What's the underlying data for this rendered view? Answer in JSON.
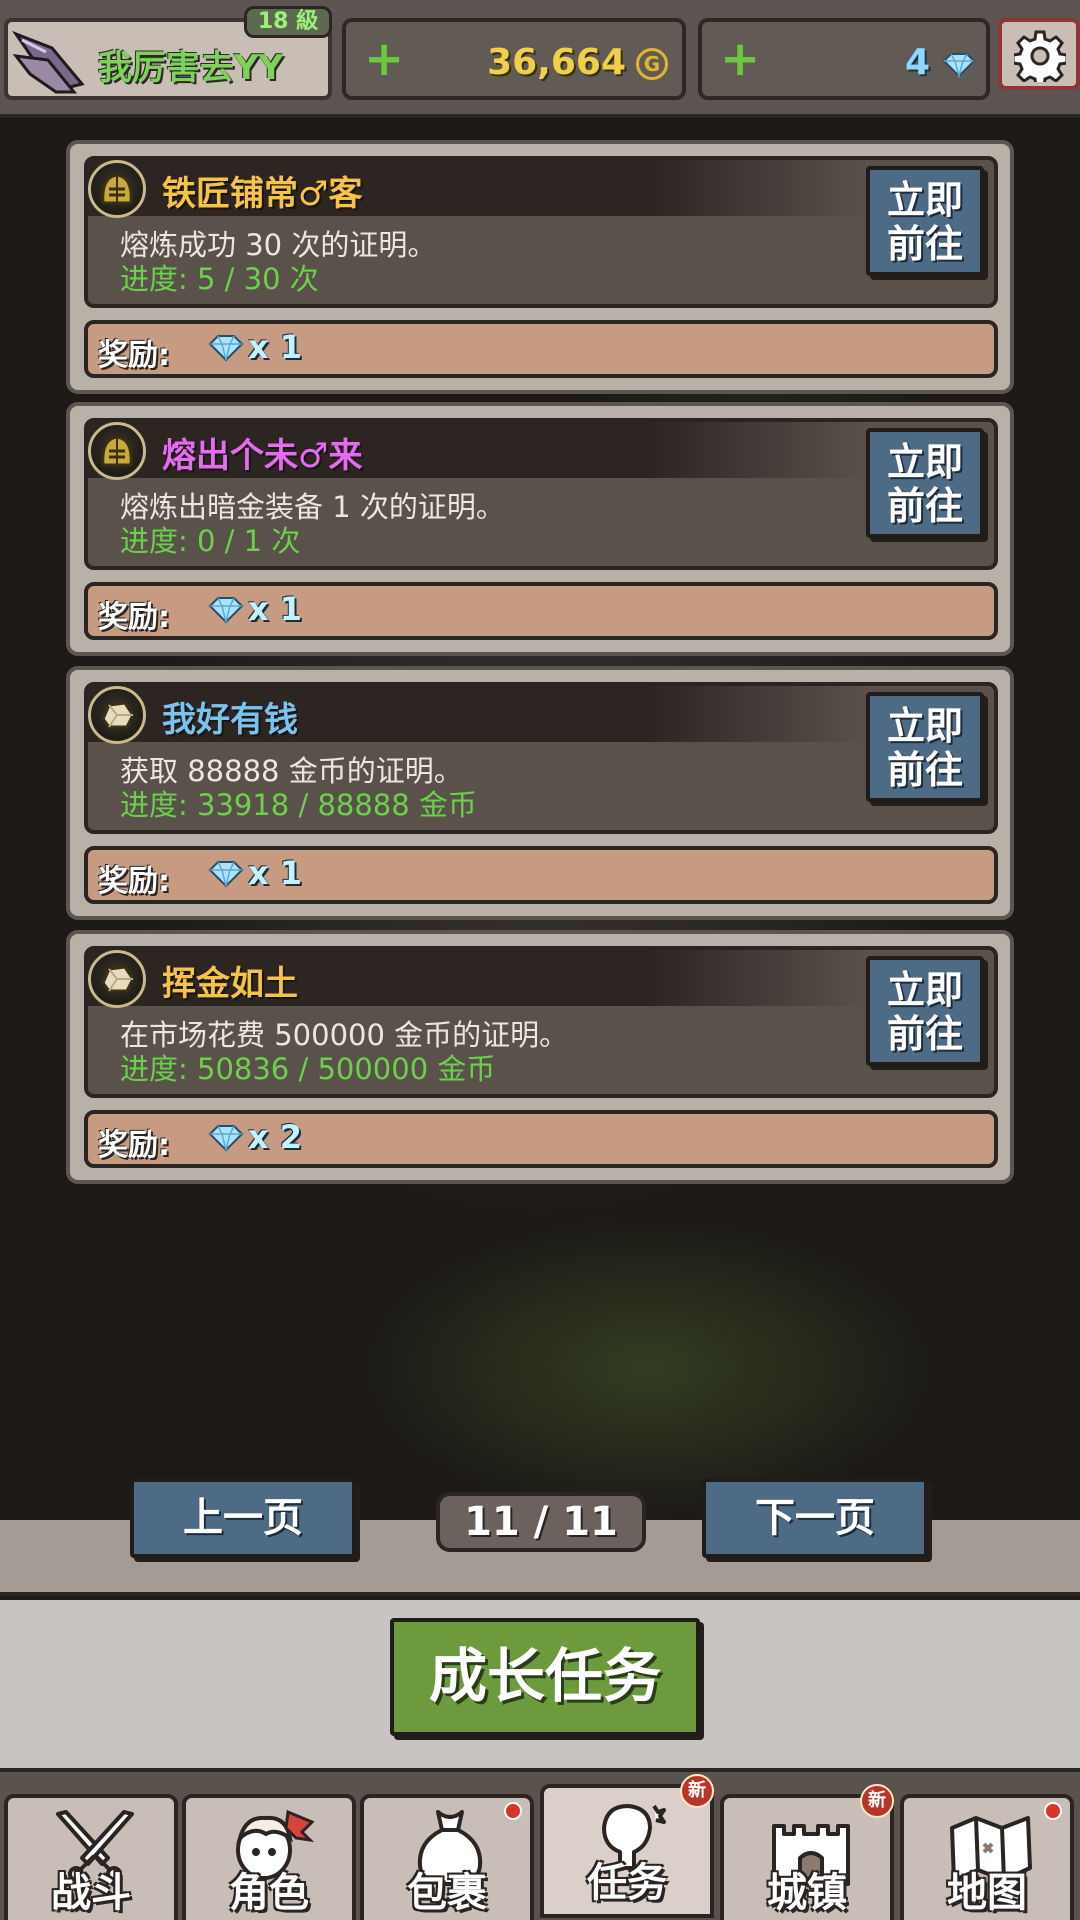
{
  "player": {
    "name": "我厉害去YY",
    "level": "18 級"
  },
  "resources": {
    "gold": "36,664",
    "gold_icon_glyph": "G",
    "gems": "4"
  },
  "quests": [
    {
      "title": "铁匠铺常♂客",
      "title_color": "#f5c34a",
      "icon": "helmet-icon",
      "desc": "熔炼成功 30 次的证明。",
      "progress": "进度: 5 / 30 次",
      "go_label": "立即\n前往",
      "reward_label": "奖励:",
      "reward_amount": "x 1"
    },
    {
      "title": "熔出个未♂来",
      "title_color": "#e36cf0",
      "icon": "helmet-icon",
      "desc": "熔炼出暗金装备 1 次的证明。",
      "progress": "进度: 0 / 1 次",
      "go_label": "立即\n前往",
      "reward_label": "奖励:",
      "reward_amount": "x 1"
    },
    {
      "title": "我好有钱",
      "title_color": "#79c3ef",
      "icon": "ore-icon",
      "desc": "获取 88888 金币的证明。",
      "progress": "进度: 33918 / 88888 金币",
      "go_label": "立即\n前往",
      "reward_label": "奖励:",
      "reward_amount": "x 1"
    },
    {
      "title": "挥金如土",
      "title_color": "#f5c34a",
      "icon": "ore-icon",
      "desc": "在市场花费 500000 金币的证明。",
      "progress": "进度: 50836 / 500000 金币",
      "go_label": "立即\n前往",
      "reward_label": "奖励:",
      "reward_amount": "x 2"
    }
  ],
  "pagination": {
    "prev": "上一页",
    "page": "11 / 11",
    "next": "下一页"
  },
  "main_button": "成长任务",
  "nav": [
    {
      "label": "战斗",
      "icon": "swords-icon"
    },
    {
      "label": "角色",
      "icon": "character-icon"
    },
    {
      "label": "包裹",
      "icon": "bag-icon"
    },
    {
      "label": "任务",
      "icon": "quest-icon",
      "badge": "新"
    },
    {
      "label": "城镇",
      "icon": "castle-icon",
      "badge": "新"
    },
    {
      "label": "地图",
      "icon": "map-icon"
    }
  ],
  "colors": {
    "accent_green": "#6e9a3e",
    "button_blue": "#4d6b85",
    "progress_green": "#6bd14b"
  }
}
